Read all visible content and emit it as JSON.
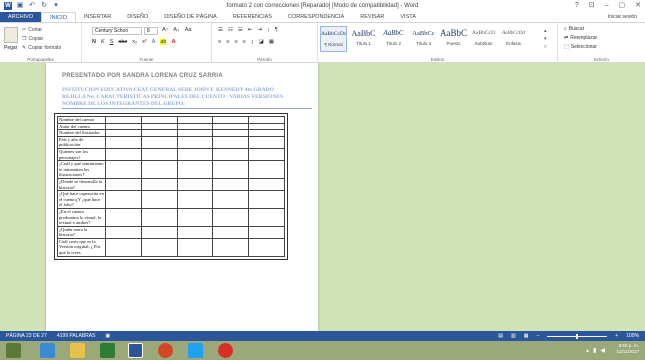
{
  "window": {
    "title": "formato 2 con correcciones [Reparado] [Modo de compatibilidad] - Word",
    "controls": [
      "?",
      "⊡",
      "–",
      "▢",
      "✕"
    ],
    "sign_in": "Iniciar sesión"
  },
  "ribbon_tabs": [
    "ARCHIVO",
    "INICIO",
    "INSERTAR",
    "DISEÑO",
    "DISEÑO DE PÁGINA",
    "REFERENCIAS",
    "CORRESPONDENCIA",
    "REVISAR",
    "VISTA"
  ],
  "clipboard": {
    "paste": "Pegar",
    "cut": "Cortar",
    "copy": "Copiar",
    "format_painter": "Copiar formato",
    "label": "Portapapeles"
  },
  "font": {
    "name": "Century Schoo",
    "size": "8",
    "format_buttons": [
      "N",
      "K",
      "S",
      "abc",
      "x₂",
      "x²"
    ],
    "label": "Fuente"
  },
  "paragraph": {
    "label": "Párrafo"
  },
  "styles": {
    "items": [
      {
        "sample": "AaBbCcDc",
        "name": "¶ Normal"
      },
      {
        "sample": "AaBbC",
        "name": "Título 1"
      },
      {
        "sample": "AaBbC",
        "name": "Título 2"
      },
      {
        "sample": "AaBbCc",
        "name": "Título 3"
      },
      {
        "sample": "AaBbC",
        "name": "Puesto"
      },
      {
        "sample": "AaBbCcD",
        "name": "Subtítulo"
      },
      {
        "sample": "AaBbCcDd",
        "name": "Énfasis"
      }
    ],
    "label": "Estilos"
  },
  "editing": {
    "find": "Buscar",
    "replace": "Reemplazar",
    "select": "Seleccionar",
    "label": "Edición"
  },
  "document": {
    "presentado": "PRESENTADO POR SANDRA LORENA CRUZ SARRIA",
    "line1": "INSTITUCION EDUCATIVA CEAT GENERAL        SEDE JOHN F. KENNEDY     4to GRADO",
    "line2": "REJILLA No.   CARACTERISTICAS PRINCIPALES DEL CUENTO - VARIAS VERSIONES",
    "line3": "NOMBRE DE LOS INTEGRANTES DEL GRUPO:",
    "table_rows": [
      "Nombre del cuento",
      "Autor del cuento",
      "Nombre del ilustrador",
      "País y año de publicación",
      "Quienes son los personajes?",
      "¿Cuál y qué sentimiento te transmiten las ilustraciones?",
      "¿Dónde se desarrolla la historia?",
      "¿Qué hace caperucita en el cuento¿Y ¿qué hace el lobo?",
      "¿En el cuento predomina lo visual, lo textual o ambos?",
      "¿Quién narra la historia?",
      "Cuál crees que es la Versión original, ¿ Por qué la crees"
    ]
  },
  "status": {
    "page": "PÁGINA 23 DE 27",
    "words": "4199 PALABRAS",
    "zoom": "100%"
  },
  "taskbar": {
    "time": "8:55 p. m.",
    "date": "13/11/2017"
  }
}
